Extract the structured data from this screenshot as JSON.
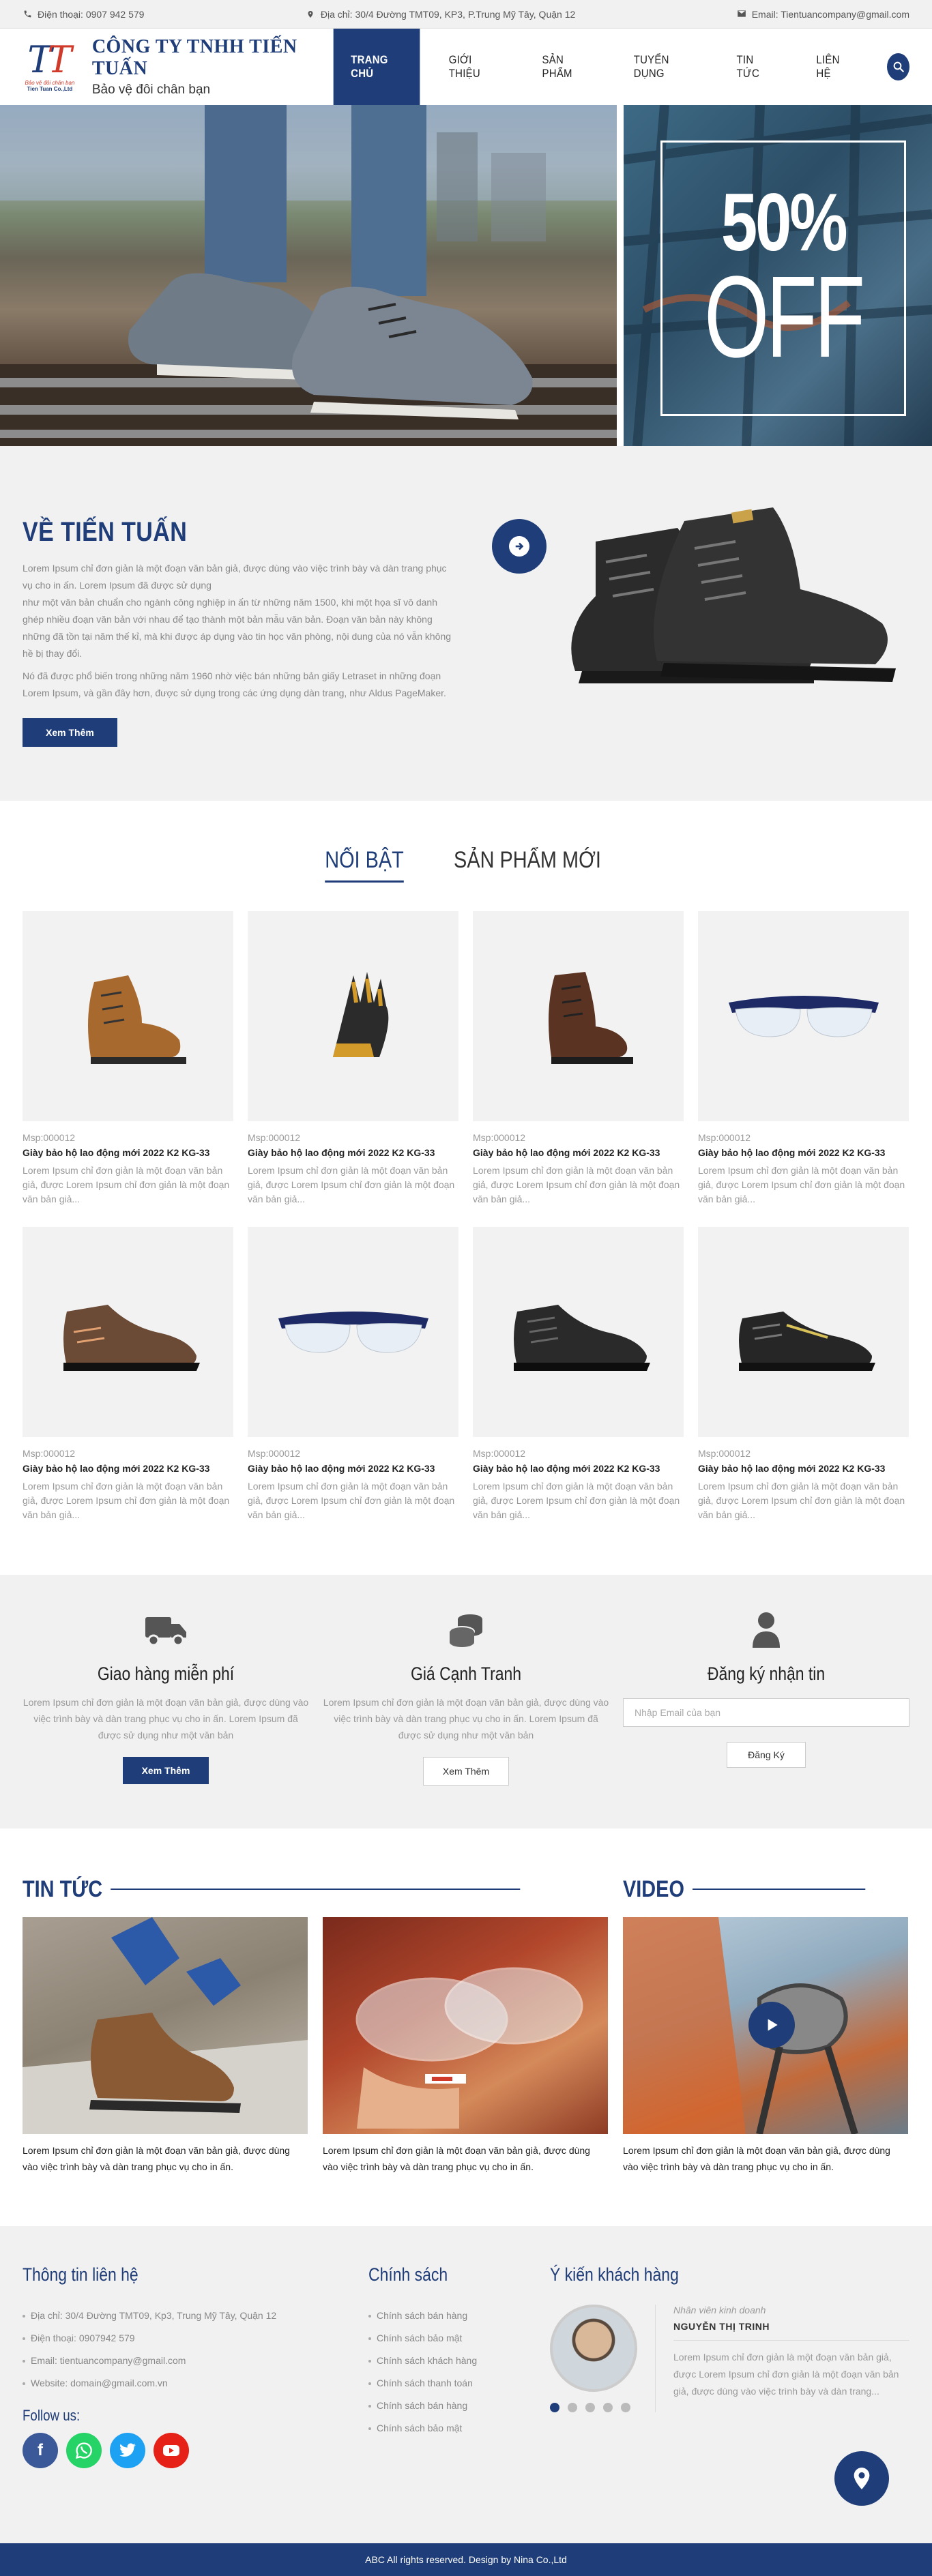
{
  "topbar": {
    "phone": "Điện thoại: 0907 942 579",
    "address": "Địa chỉ: 30/4 Đường TMT09, KP3, P.Trung Mỹ Tây, Quận 12",
    "email": "Email: Tientuancompany@gmail.com"
  },
  "header": {
    "logo_slogan": "Bảo vệ đôi chân bạn",
    "logo_company": "Tien Tuan Co.,Ltd",
    "company_name": "CÔNG TY TNHH TIẾN TUẤN",
    "tagline": "Bảo vệ đôi chân bạn",
    "nav": [
      "TRANG CHỦ",
      "GIỚI THIỆU",
      "SẢN PHẨM",
      "TUYỂN DỤNG",
      "TIN TỨC",
      "LIÊN HỆ"
    ]
  },
  "hero": {
    "sale_percent": "50%",
    "sale_word": "OFF"
  },
  "about": {
    "title": "VỀ TIẾN TUẤN",
    "p1": "Lorem Ipsum chỉ đơn giản là một đoạn văn bản giả, được dùng vào việc trình bày và dàn trang phục vụ cho in ấn. Lorem Ipsum đã được sử dụng",
    "p2": "như một văn bản chuẩn cho ngành công nghiệp in ấn từ những năm 1500, khi một họa sĩ vô danh ghép nhiều đoạn văn bản với nhau để tạo thành một bản mẫu văn bản. Đoạn văn bản này không những đã tồn tại năm thế kỉ, mà khi được áp dụng vào tin học văn phòng, nội dung của nó vẫn không hề bị thay đổi.",
    "p3": "Nó đã được phổ biến trong những năm 1960 nhờ việc bán những bản giấy Letraset in những đoạn Lorem Ipsum, và gần đây hơn, được sử dụng trong các ứng dụng dàn trang, như Aldus PageMaker.",
    "button": "Xem Thêm"
  },
  "products": {
    "tabs": [
      "NỔI BẬT",
      "SẢN PHẨM MỚI"
    ],
    "items": [
      {
        "code": "Msp:000012",
        "name": "Giày bảo hộ lao động mới 2022 K2 KG-33",
        "desc": "Lorem Ipsum chỉ đơn giản là một đoạn văn bản giả, được Lorem Ipsum chỉ đơn giản là một đoạn văn bản giả..."
      },
      {
        "code": "Msp:000012",
        "name": "Giày bảo hộ lao động mới 2022 K2 KG-33",
        "desc": "Lorem Ipsum chỉ đơn giản là một đoạn văn bản giả, được Lorem Ipsum chỉ đơn giản là một đoạn văn bản giả..."
      },
      {
        "code": "Msp:000012",
        "name": "Giày bảo hộ lao động mới 2022 K2 KG-33",
        "desc": "Lorem Ipsum chỉ đơn giản là một đoạn văn bản giả, được Lorem Ipsum chỉ đơn giản là một đoạn văn bản giả..."
      },
      {
        "code": "Msp:000012",
        "name": "Giày bảo hộ lao động mới 2022 K2 KG-33",
        "desc": "Lorem Ipsum chỉ đơn giản là một đoạn văn bản giả, được Lorem Ipsum chỉ đơn giản là một đoạn văn bản giả..."
      },
      {
        "code": "Msp:000012",
        "name": "Giày bảo hộ lao động mới 2022 K2 KG-33",
        "desc": "Lorem Ipsum chỉ đơn giản là một đoạn văn bản giả, được Lorem Ipsum chỉ đơn giản là một đoạn văn bản giả..."
      },
      {
        "code": "Msp:000012",
        "name": "Giày bảo hộ lao động mới 2022 K2 KG-33",
        "desc": "Lorem Ipsum chỉ đơn giản là một đoạn văn bản giả, được Lorem Ipsum chỉ đơn giản là một đoạn văn bản giả..."
      },
      {
        "code": "Msp:000012",
        "name": "Giày bảo hộ lao động mới 2022 K2 KG-33",
        "desc": "Lorem Ipsum chỉ đơn giản là một đoạn văn bản giả, được Lorem Ipsum chỉ đơn giản là một đoạn văn bản giả..."
      },
      {
        "code": "Msp:000012",
        "name": "Giày bảo hộ lao động mới 2022 K2 KG-33",
        "desc": "Lorem Ipsum chỉ đơn giản là một đoạn văn bản giả, được Lorem Ipsum chỉ đơn giản là một đoạn văn bản giả..."
      }
    ]
  },
  "services": {
    "shipping_title": "Giao hàng miễn phí",
    "shipping_desc": "Lorem Ipsum chỉ đơn giản là một đoạn văn bản giả, được dùng vào việc trình bày và dàn trang phục vụ cho in ấn. Lorem Ipsum đã được sử dụng như một văn bản",
    "shipping_button": "Xem Thêm",
    "price_title": "Giá Cạnh Tranh",
    "price_desc": "Lorem Ipsum chỉ đơn giản là một đoạn văn bản giả, được dùng vào việc trình bày và dàn trang phục vụ cho in ấn. Lorem Ipsum đã được sử dụng như một văn bản",
    "price_button": "Xem Thêm",
    "subscribe_title": "Đăng ký nhận tin",
    "subscribe_placeholder": "Nhập Email của bạn",
    "subscribe_button": "Đăng Ký"
  },
  "news": {
    "title": "TIN TỨC",
    "video_title": "VIDEO",
    "item1": "Lorem Ipsum chỉ đơn giản là một đoạn văn bản giả, được dùng vào việc trình bày và dàn trang phục vụ cho in ấn.",
    "item2": "Lorem Ipsum chỉ đơn giản là một đoạn văn bản giả, được dùng vào việc trình bày và dàn trang phục vụ cho in ấn.",
    "video_caption": "Lorem Ipsum chỉ đơn giản là một đoạn văn bản giả, được dùng vào việc trình bày và dàn trang phục vụ cho in ấn."
  },
  "footer": {
    "contact_title": "Thông tin liên hệ",
    "contact": [
      "Địa chỉ: 30/4 Đường TMT09, Kp3, Trung Mỹ Tây, Quận 12",
      "Điện thoại: 0907942 579",
      "Email: tientuancompany@gmail.com",
      "Website: domain@gmail.com.vn"
    ],
    "follow": "Follow us:",
    "policy_title": "Chính sách",
    "policies": [
      "Chính sách bán hàng",
      "Chính sách bảo mật",
      "Chính sách khách hàng",
      "Chính sách thanh toán",
      "Chính sách bán hàng",
      "Chính sách bảo mật"
    ],
    "testimonial_title": "Ý kiến khách hàng",
    "testimonial_role": "Nhân viên kinh doanh",
    "testimonial_name": "NGUYỄN THỊ TRINH",
    "testimonial_text": "Lorem Ipsum chỉ đơn giản là một đoạn văn bản giả, được Lorem Ipsum chỉ đơn giản là một đoạn văn bản giả, được dùng vào việc trình bày và dàn trang...",
    "copyright": "ABC All rights reserved. Design by Nina Co.,Ltd"
  },
  "colors": {
    "brand": "#1f3d78",
    "accent_red": "#d03a2b",
    "facebook": "#3b5998",
    "whatsapp": "#25d366",
    "twitter": "#1da1f2",
    "youtube": "#e62117"
  }
}
